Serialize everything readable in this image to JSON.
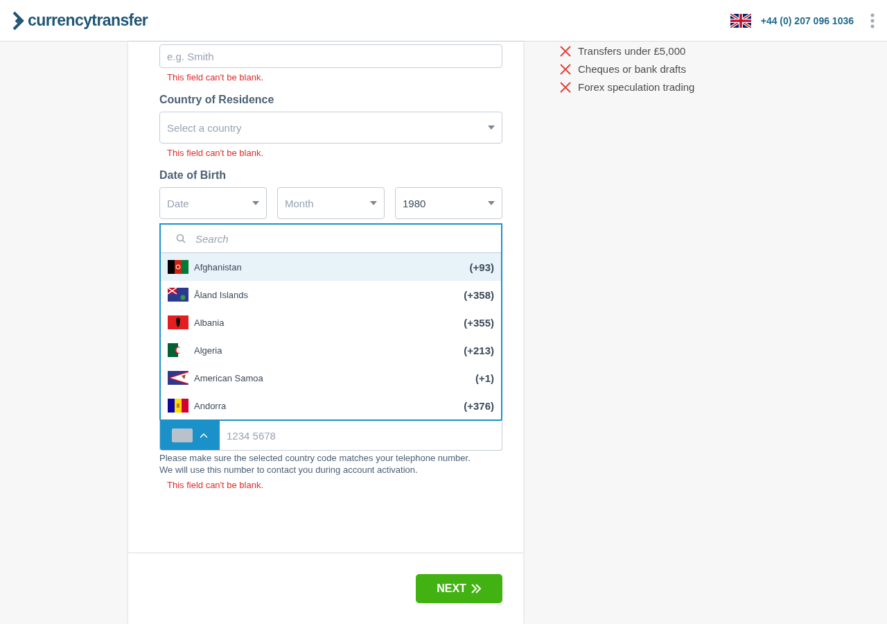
{
  "header": {
    "logo": "currencytransfer",
    "phone": "+44 (0) 207 096 1036"
  },
  "form": {
    "surname": {
      "placeholder": "e.g. Smith",
      "error": "This field can't be blank."
    },
    "country": {
      "label": "Country of Residence",
      "placeholder": "Select a country",
      "error": "This field can't be blank."
    },
    "dob": {
      "label": "Date of Birth",
      "fields": [
        {
          "placeholder": "Date"
        },
        {
          "placeholder": "Month"
        },
        {
          "value": "1980"
        }
      ]
    },
    "phone": {
      "expanded": true,
      "search_placeholder": "Search",
      "placeholder": "1234 5678",
      "countries": [
        {
          "name": "Afghanistan",
          "code": "(+93)",
          "selected": true
        },
        {
          "name": "Åland Islands",
          "code": "(+358)",
          "selected": false
        },
        {
          "name": "Albania",
          "code": "(+355)",
          "selected": false
        },
        {
          "name": "Algeria",
          "code": "(+213)",
          "selected": false
        },
        {
          "name": "American Samoa",
          "code": "(+1)",
          "selected": false
        },
        {
          "name": "Andorra",
          "code": "(+376)",
          "selected": false
        }
      ],
      "hint": [
        "Please make sure the selected country code matches your telephone number.",
        "We will use this number to contact you during account activation."
      ],
      "error": "This field can't be blank."
    },
    "next_button": "NEXT"
  },
  "exclusions": [
    "Transfers under £5,000",
    "Cheques or bank drafts",
    "Forex speculation trading"
  ]
}
